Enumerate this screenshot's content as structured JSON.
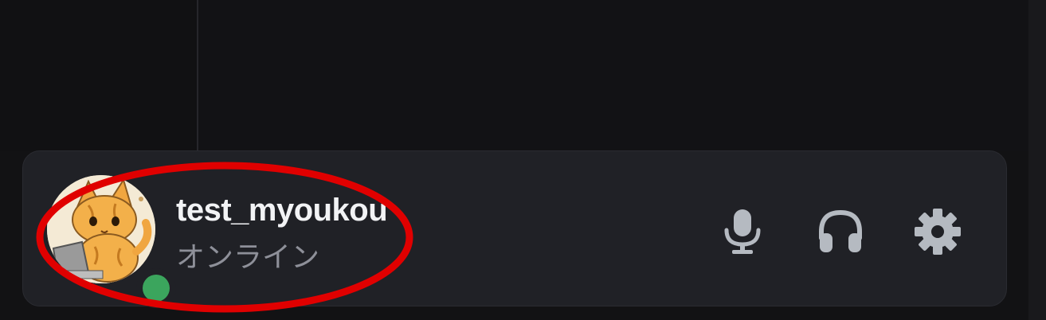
{
  "user": {
    "username": "test_myoukou",
    "status": "オンライン",
    "status_color": "#3ba55d",
    "avatar": "cat-avatar-image"
  },
  "controls": {
    "mic_icon": "microphone-icon",
    "headset_icon": "headphones-icon",
    "settings_icon": "gear-icon",
    "icon_color": "#b5bac1"
  },
  "annotation": {
    "shape": "ellipse",
    "color": "#e00000"
  }
}
